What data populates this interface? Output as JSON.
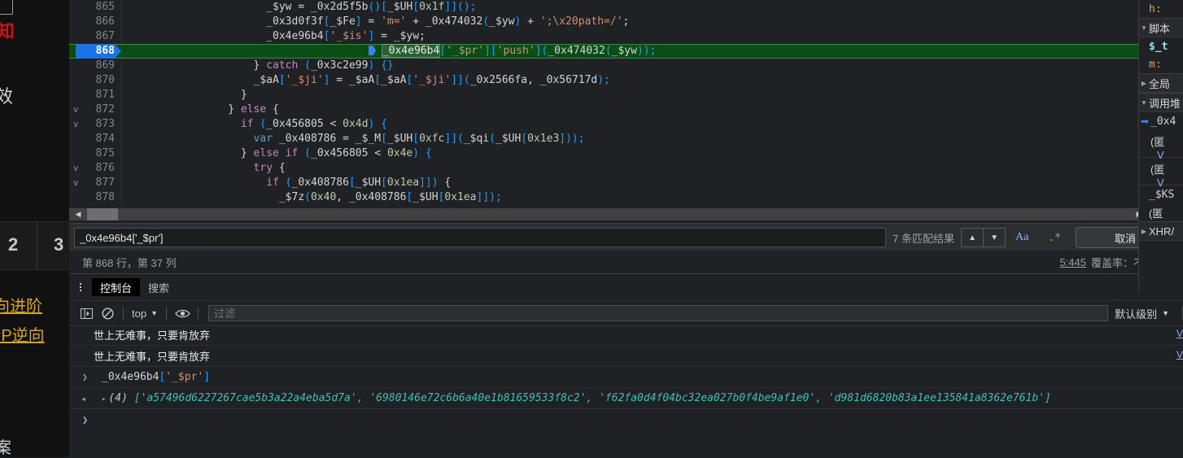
{
  "page_behind": {
    "red_text": "知",
    "gray_text": "效",
    "tab_numbers": [
      "2",
      "3"
    ],
    "links": [
      "向进阶",
      "PP逆向"
    ],
    "answer_text": "案"
  },
  "sources": {
    "lines": [
      {
        "num": "865",
        "fold": "",
        "highlight": false,
        "tokens": [
          {
            "t": "                      _$yw ",
            "c": "pl"
          },
          {
            "t": "=",
            "c": "pl"
          },
          {
            "t": " _0x2d5f5b",
            "c": "pl"
          },
          {
            "t": "()[",
            "c": "paren"
          },
          {
            "t": "_$UH",
            "c": "pl"
          },
          {
            "t": "[",
            "c": "paren"
          },
          {
            "t": "0x1f",
            "c": "num"
          },
          {
            "t": "]]",
            "c": "paren"
          },
          {
            "t": "();",
            "c": "paren"
          }
        ]
      },
      {
        "num": "866",
        "fold": "",
        "highlight": false,
        "tokens": [
          {
            "t": "                      _0x3d0f3f",
            "c": "pl"
          },
          {
            "t": "[",
            "c": "paren"
          },
          {
            "t": "_$Fe",
            "c": "pl"
          },
          {
            "t": "]",
            "c": "paren"
          },
          {
            "t": " = ",
            "c": "pl"
          },
          {
            "t": "'m='",
            "c": "str"
          },
          {
            "t": " + _0x474032",
            "c": "pl"
          },
          {
            "t": "(",
            "c": "paren"
          },
          {
            "t": "_$yw",
            "c": "pl"
          },
          {
            "t": ")",
            "c": "paren"
          },
          {
            "t": " + ",
            "c": "pl"
          },
          {
            "t": "';\\x20path=/'",
            "c": "str"
          },
          {
            "t": ";",
            "c": "pl"
          }
        ]
      },
      {
        "num": "867",
        "fold": "",
        "highlight": false,
        "tokens": [
          {
            "t": "                      _0x4e96b4",
            "c": "pl"
          },
          {
            "t": "[",
            "c": "paren"
          },
          {
            "t": "'_$is'",
            "c": "str"
          },
          {
            "t": "]",
            "c": "paren"
          },
          {
            "t": " = _$yw;",
            "c": "pl"
          }
        ]
      },
      {
        "num": "868",
        "fold": "",
        "highlight": true,
        "tokens": [
          {
            "t": "_0x4e96b4",
            "c": "sel"
          },
          {
            "t": "[",
            "c": "paren"
          },
          {
            "t": "'_$pr'",
            "c": "str"
          },
          {
            "t": "]",
            "c": "paren"
          },
          {
            "t": "[",
            "c": "paren"
          },
          {
            "t": "'push'",
            "c": "str"
          },
          {
            "t": "]",
            "c": "paren"
          },
          {
            "t": "(",
            "c": "paren"
          },
          {
            "t": "_0x474032",
            "c": "pl"
          },
          {
            "t": "(",
            "c": "paren"
          },
          {
            "t": "_$yw",
            "c": "pl"
          },
          {
            "t": "));",
            "c": "paren"
          }
        ]
      },
      {
        "num": "869",
        "fold": "",
        "highlight": false,
        "tokens": [
          {
            "t": "                    } ",
            "c": "pl"
          },
          {
            "t": "catch",
            "c": "kw"
          },
          {
            "t": " (",
            "c": "paren"
          },
          {
            "t": "_0x3c2e99",
            "c": "pl"
          },
          {
            "t": ") {}",
            "c": "paren"
          }
        ]
      },
      {
        "num": "870",
        "fold": "",
        "highlight": false,
        "tokens": [
          {
            "t": "                    _$aA",
            "c": "pl"
          },
          {
            "t": "[",
            "c": "paren"
          },
          {
            "t": "'_$ji'",
            "c": "str"
          },
          {
            "t": "]",
            "c": "paren"
          },
          {
            "t": " = _$aA",
            "c": "pl"
          },
          {
            "t": "[",
            "c": "paren"
          },
          {
            "t": "_$aA",
            "c": "pl"
          },
          {
            "t": "[",
            "c": "paren"
          },
          {
            "t": "'_$ji'",
            "c": "str"
          },
          {
            "t": "]]",
            "c": "paren"
          },
          {
            "t": "(",
            "c": "paren"
          },
          {
            "t": "_0x2566fa",
            "c": "pl"
          },
          {
            "t": ", _0x56717d",
            "c": "pl"
          },
          {
            "t": ");",
            "c": "paren"
          }
        ]
      },
      {
        "num": "871",
        "fold": "",
        "highlight": false,
        "tokens": [
          {
            "t": "                  }",
            "c": "pl"
          }
        ]
      },
      {
        "num": "872",
        "fold": "v",
        "highlight": false,
        "tokens": [
          {
            "t": "                } ",
            "c": "pl"
          },
          {
            "t": "else",
            "c": "kw"
          },
          {
            "t": " {",
            "c": "pl"
          }
        ]
      },
      {
        "num": "873",
        "fold": "v",
        "highlight": false,
        "tokens": [
          {
            "t": "                  ",
            "c": "pl"
          },
          {
            "t": "if",
            "c": "kw"
          },
          {
            "t": " (",
            "c": "paren"
          },
          {
            "t": "_0x456805",
            "c": "pl"
          },
          {
            "t": " < ",
            "c": "pl"
          },
          {
            "t": "0x4d",
            "c": "num"
          },
          {
            "t": ") {",
            "c": "paren"
          }
        ]
      },
      {
        "num": "874",
        "fold": "",
        "highlight": false,
        "tokens": [
          {
            "t": "                    ",
            "c": "pl"
          },
          {
            "t": "var",
            "c": "kw2"
          },
          {
            "t": " _0x408786 = _$_M",
            "c": "pl"
          },
          {
            "t": "[",
            "c": "paren"
          },
          {
            "t": "_$UH",
            "c": "pl"
          },
          {
            "t": "[",
            "c": "paren"
          },
          {
            "t": "0xfc",
            "c": "num"
          },
          {
            "t": "]]",
            "c": "paren"
          },
          {
            "t": "(",
            "c": "paren"
          },
          {
            "t": "_$qi",
            "c": "pl"
          },
          {
            "t": "(",
            "c": "paren"
          },
          {
            "t": "_$UH",
            "c": "pl"
          },
          {
            "t": "[",
            "c": "paren"
          },
          {
            "t": "0x1e3",
            "c": "num"
          },
          {
            "t": "]));",
            "c": "paren"
          }
        ]
      },
      {
        "num": "875",
        "fold": "",
        "highlight": false,
        "tokens": [
          {
            "t": "                  } ",
            "c": "pl"
          },
          {
            "t": "else if",
            "c": "kw"
          },
          {
            "t": " (",
            "c": "paren"
          },
          {
            "t": "_0x456805",
            "c": "pl"
          },
          {
            "t": " < ",
            "c": "pl"
          },
          {
            "t": "0x4e",
            "c": "num"
          },
          {
            "t": ") {",
            "c": "paren"
          }
        ]
      },
      {
        "num": "876",
        "fold": "v",
        "highlight": false,
        "tokens": [
          {
            "t": "                    ",
            "c": "pl"
          },
          {
            "t": "try",
            "c": "kw"
          },
          {
            "t": " {",
            "c": "pl"
          }
        ]
      },
      {
        "num": "877",
        "fold": "v",
        "highlight": false,
        "tokens": [
          {
            "t": "                      ",
            "c": "pl"
          },
          {
            "t": "if",
            "c": "kw"
          },
          {
            "t": " (",
            "c": "paren"
          },
          {
            "t": "_0x408786",
            "c": "pl"
          },
          {
            "t": "[",
            "c": "paren"
          },
          {
            "t": "_$UH",
            "c": "pl"
          },
          {
            "t": "[",
            "c": "paren"
          },
          {
            "t": "0x1ea",
            "c": "num"
          },
          {
            "t": "]])",
            "c": "paren"
          },
          {
            "t": " {",
            "c": "pl"
          }
        ]
      },
      {
        "num": "878",
        "fold": "",
        "highlight": false,
        "tokens": [
          {
            "t": "                        _$7z",
            "c": "pl"
          },
          {
            "t": "(",
            "c": "paren"
          },
          {
            "t": "0x40",
            "c": "num"
          },
          {
            "t": ", _0x408786",
            "c": "pl"
          },
          {
            "t": "[",
            "c": "paren"
          },
          {
            "t": "_$UH",
            "c": "pl"
          },
          {
            "t": "[",
            "c": "paren"
          },
          {
            "t": "0x1ea",
            "c": "num"
          },
          {
            "t": "]]);",
            "c": "paren"
          }
        ]
      }
    ]
  },
  "find": {
    "value": "_0x4e96b4['_$pr']",
    "match_count": "7 条匹配结果",
    "prev_icon": "chevron-up",
    "next_icon": "chevron-down",
    "match_case_label": "Aa",
    "regex_label": ".*",
    "cancel_label": "取消"
  },
  "status": {
    "position": "第 868 行，第 37 列",
    "coverage_link": "5:445",
    "coverage_label": "覆盖率：不适用"
  },
  "drawer": {
    "tabs": [
      {
        "label": "控制台",
        "active": true
      },
      {
        "label": "搜索",
        "active": false
      }
    ],
    "toolbar": {
      "sidebar_icon": "console-sidebar-icon",
      "clear_icon": "clear-console-icon",
      "context": "top",
      "context_caret": "▼",
      "eye_icon": "live-expression-icon",
      "filter_placeholder": "过滤",
      "filter_value": "",
      "level": "默认级别",
      "level_caret": "▼"
    },
    "messages": [
      {
        "kind": "log",
        "text": "世上无难事，只要肯放弃",
        "source": "V",
        "arrow": ""
      },
      {
        "kind": "log",
        "text": "世上无难事，只要肯放弃",
        "source": "V",
        "arrow": ""
      },
      {
        "kind": "input",
        "text": "_0x4e96b4['_$pr']",
        "arrow": "❯"
      },
      {
        "kind": "result",
        "count": "(4)",
        "arrow": "◂",
        "tri": "▸",
        "items": [
          "'a57496d6227267cae5b3a22a4eba5d7a'",
          "'6980146e72c6b6a40e1b81659533f8c2'",
          "'f62fa0d4f04bc32ea027b0f4be9af1e0'",
          "'d981d6820b83a1ee135841a8362e761b'"
        ]
      }
    ],
    "prompt_arrow": "❯"
  },
  "right_sidebar": {
    "rows": [
      {
        "type": "prop",
        "tri": "",
        "label": "h:",
        "style": "mono"
      },
      {
        "type": "section",
        "tri": "▼",
        "label": "脚本",
        "style": "plain"
      },
      {
        "type": "prop",
        "tri": "",
        "label": "$_t",
        "style": "blue"
      },
      {
        "type": "prop",
        "tri": "",
        "label": "m:",
        "style": "mono"
      },
      {
        "type": "section",
        "tri": "▶",
        "label": "全局",
        "style": "plain"
      },
      {
        "type": "section",
        "tri": "▼",
        "label": "调用堆",
        "style": "plain"
      },
      {
        "type": "frame",
        "tri": "",
        "label": "_0x4",
        "style": "current"
      },
      {
        "type": "call",
        "l1": "(匿",
        "l2": "V"
      },
      {
        "type": "call",
        "l1": "(匿",
        "l2": "V"
      },
      {
        "type": "prop",
        "tri": "",
        "label": "_$KS",
        "style": "mono2"
      },
      {
        "type": "prop",
        "tri": "",
        "label": "(匿",
        "style": "plain"
      },
      {
        "type": "section",
        "tri": "▶",
        "label": "XHR/",
        "style": "plain"
      }
    ]
  },
  "colors": {
    "highlight_line": "#0b4d17",
    "highlight_border": "#2f8f3e",
    "linenum_active": "#1a73e8",
    "accent_link": "#8ab4f8",
    "string": "#ce9178",
    "keyword": "#c586c0",
    "number": "#b5cea8"
  }
}
